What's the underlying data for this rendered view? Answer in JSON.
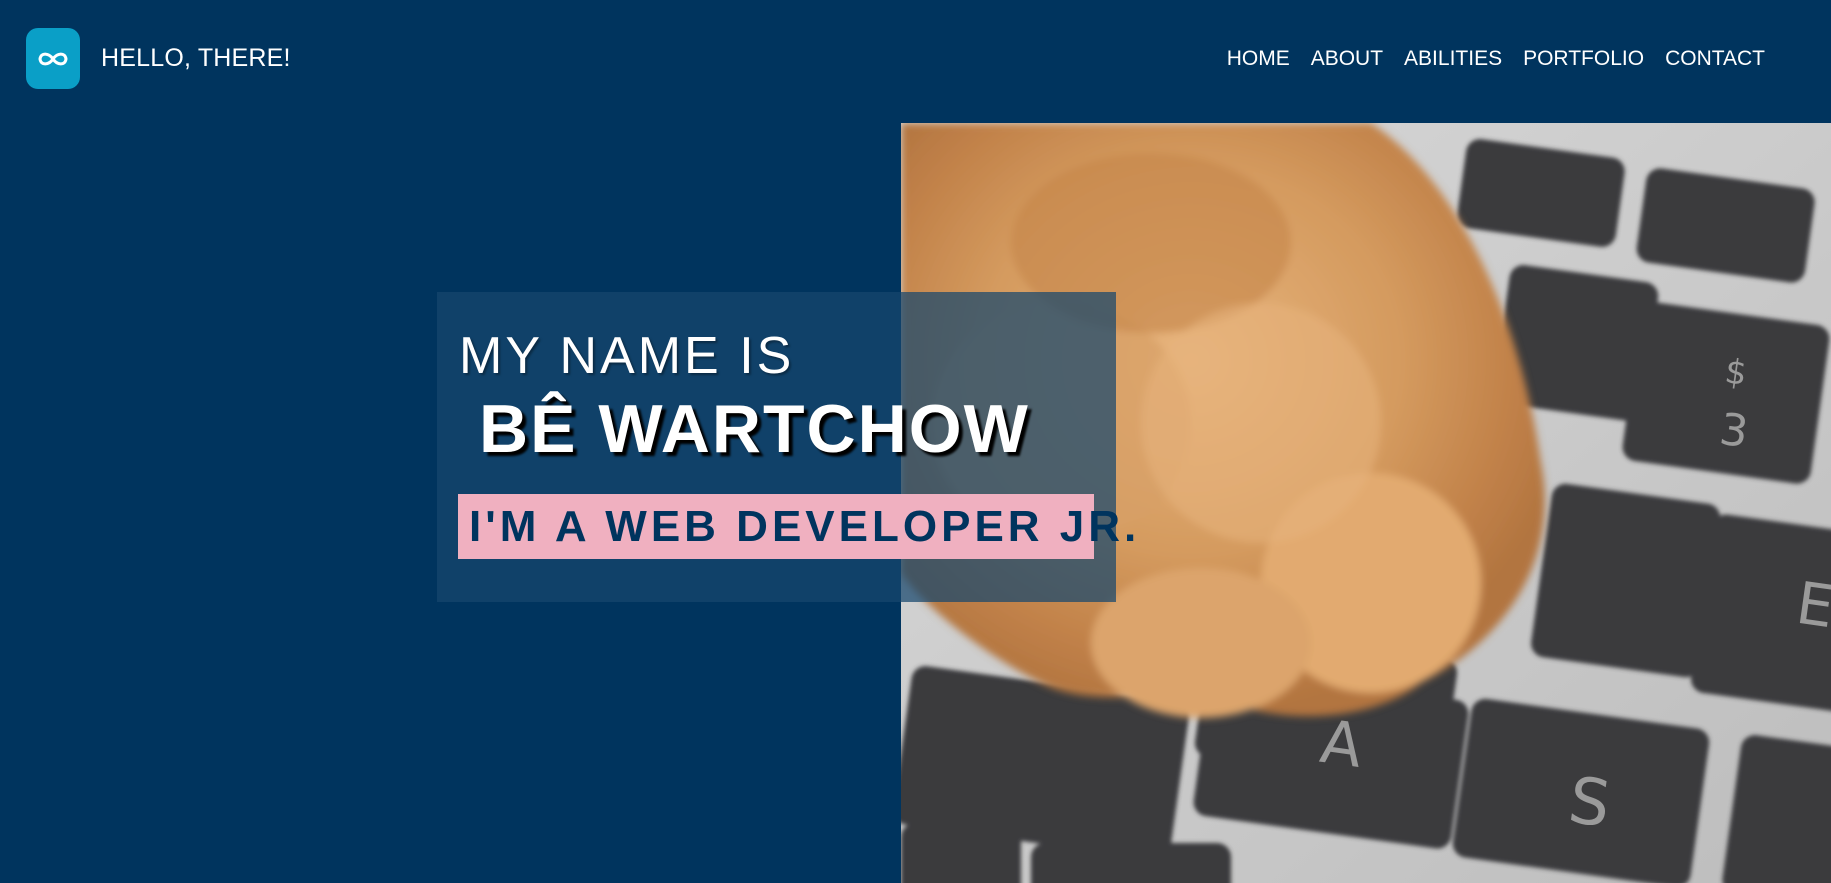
{
  "header": {
    "logo_icon": "infinity-icon",
    "site_title": "HELLO, THERE!",
    "nav": [
      {
        "label": "HOME"
      },
      {
        "label": "ABOUT"
      },
      {
        "label": "ABILITIES"
      },
      {
        "label": "PORTFOLIO"
      },
      {
        "label": "CONTACT"
      }
    ]
  },
  "hero": {
    "intro": "MY NAME IS",
    "name": "BÊ WARTCHOW",
    "role": "I'M A WEB DEVELOPER JR."
  },
  "colors": {
    "background": "#00345e",
    "logo": "#0a9fc7",
    "role_highlight": "#f0b0c0",
    "text": "#ffffff"
  }
}
